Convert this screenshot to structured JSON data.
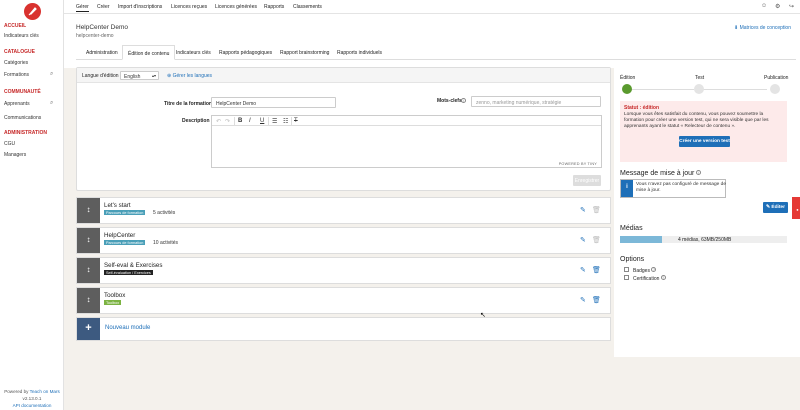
{
  "sidebar": {
    "sections": [
      {
        "heading": "ACCUEIL",
        "items": [
          "Indicateurs clés"
        ]
      },
      {
        "heading": "CATALOGUE",
        "items": [
          "Catégories",
          "Formations"
        ]
      },
      {
        "heading": "COMMUNAUTÉ",
        "items": [
          "Apprenants",
          "Communications"
        ]
      },
      {
        "heading": "ADMINISTRATION",
        "items": [
          "CGU",
          "Managers"
        ]
      }
    ],
    "footer": {
      "powered": "Powered by",
      "brand": "Teach on Mars",
      "version": "v2.13.0.1",
      "api": "API documentation"
    }
  },
  "topnav": {
    "items": [
      "Gérer",
      "Créer",
      "Import d'inscriptions",
      "Licences reçues",
      "Licences générées",
      "Rapports",
      "Classements"
    ],
    "active": "Gérer",
    "icons": [
      "user-icon",
      "gear-icon",
      "logout-icon"
    ]
  },
  "course": {
    "title": "HelpCenter Demo",
    "subtitle": "helpcenter-demo",
    "design_link": "Matrices de conception"
  },
  "tabs": [
    "Administration",
    "Édition de contenu",
    "Indicateurs clés",
    "Rapports pédagogiques",
    "Rapport brainstorming",
    "Rapports individuels"
  ],
  "active_tab": "Édition de contenu",
  "form": {
    "lang_label": "Langue d'édition :",
    "lang_value": "English",
    "manage_langs": "Gérer les langues",
    "title_label": "Titre de la formation",
    "title_value": "HelpCenter Demo",
    "keywords_label": "Mots-clefs",
    "keywords_placeholder": "zenno, marketing numérique, stratégie",
    "description_label": "Description",
    "powered_by": "POWERED BY TINY",
    "save_label": "Enregistrer"
  },
  "modules": [
    {
      "title": "Let's start",
      "tag": "Parcours de formation",
      "tag_color": "#4a9fb8",
      "count": "5 activités"
    },
    {
      "title": "HelpCenter",
      "tag": "Parcours de formation",
      "tag_color": "#4a9fb8",
      "count": "10 activités"
    },
    {
      "title": "Self-eval & Exercises",
      "tag": "Self-évaluation / Exercices",
      "tag_color": "#222222",
      "count": ""
    },
    {
      "title": "Toolbox",
      "tag": "Toolbox",
      "tag_color": "#7cb342",
      "count": ""
    }
  ],
  "new_module": "Nouveau module",
  "status": {
    "steps": [
      "Édition",
      "Test",
      "Publication"
    ],
    "title": "Statut : édition",
    "text": "Lorsque vous êtes satisfait du contenu, vous pouvez soumettre la formation pour créer une version test, qui ne sera visible que par les apprenants ayant le statut « Relecteur de contenu ».",
    "button": "Créer une version test"
  },
  "update": {
    "title": "Message de mise à jour",
    "text": "Vous n'avez pas configuré de message de mise à jour.",
    "edit_button": "Éditer"
  },
  "media": {
    "title": "Médias",
    "usage_text": "4 médias, 63MB/250MB",
    "used_fraction": 0.252
  },
  "options": {
    "title": "Options",
    "items": [
      "Badges",
      "Certification"
    ]
  },
  "colors": {
    "accent_red": "#c62828",
    "link_blue": "#1e6fb8",
    "status_green": "#5a9a2e"
  }
}
